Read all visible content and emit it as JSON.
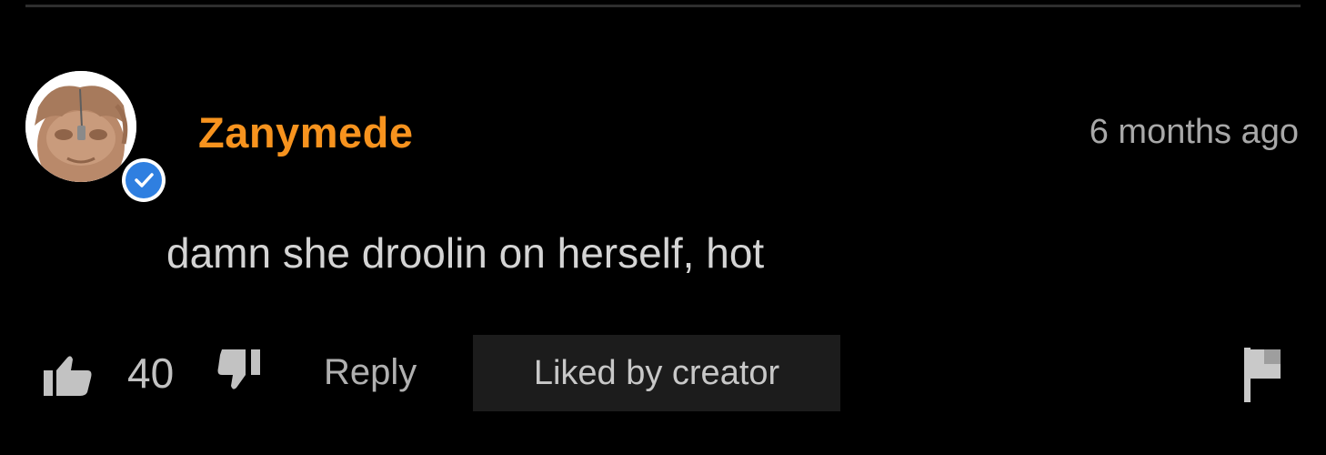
{
  "comment": {
    "username": "Zanymede",
    "timestamp": "6 months ago",
    "text": "damn she droolin on herself, hot",
    "verified": true,
    "avatar_icon": "avatar-photo",
    "verified_icon": "check-icon"
  },
  "actions": {
    "like_icon": "thumbs-up-icon",
    "like_count": "40",
    "dislike_icon": "thumbs-down-icon",
    "reply_label": "Reply",
    "liked_badge_label": "Liked by creator",
    "flag_icon": "flag-icon"
  },
  "colors": {
    "background": "#000000",
    "username": "#f7931e",
    "verified_badge": "#2f7fe0",
    "badge_background": "#1c1c1c",
    "text": "#d4d4d4",
    "muted_text": "#a8a8a8"
  }
}
